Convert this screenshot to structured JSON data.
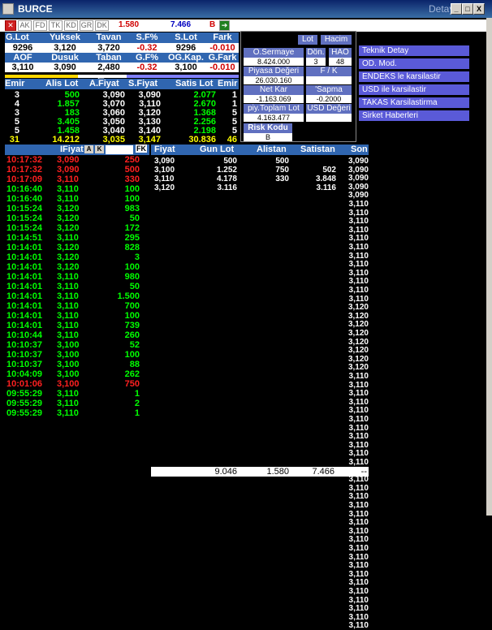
{
  "window": {
    "title": "BURCE",
    "subtitle": "Detay",
    "min": "_",
    "max": "□",
    "close": "X"
  },
  "toolbar": {
    "tabs": [
      "AK",
      "FD",
      "TK",
      "KD",
      "GR",
      "DK"
    ],
    "value1": "1.580",
    "value2": "7.466",
    "flag": "B"
  },
  "header": {
    "row1": [
      "G.Lot",
      "Yuksek",
      "Tavan",
      "S.F%",
      "S.Lot",
      "Fark"
    ],
    "row2": [
      "9296",
      "3,120",
      "3,720",
      "-0.32",
      "9296",
      "-0.010"
    ],
    "row3": [
      "AOF",
      "Dusuk",
      "Taban",
      "G.F%",
      "OG.Kap.",
      "G.Fark"
    ],
    "row4": [
      "3,110",
      "3,090",
      "2,480",
      "-0.32",
      "3,100",
      "-0.010"
    ]
  },
  "market": {
    "cols": [
      "Emir",
      "Alis Lot",
      "A.Fiyat",
      "S.Fiyat",
      "Satis Lot",
      "Emir"
    ],
    "arrow": "←"
  },
  "depth": [
    [
      "3",
      "500",
      "3,090",
      "3,090",
      "2.077",
      "1"
    ],
    [
      "4",
      "1.857",
      "3,070",
      "3,110",
      "2.670",
      "1"
    ],
    [
      "3",
      "183",
      "3,060",
      "3,120",
      "1.368",
      "5"
    ],
    [
      "5",
      "3.405",
      "3,050",
      "3,130",
      "2.256",
      "5"
    ],
    [
      "5",
      "1.458",
      "3,040",
      "3,140",
      "2.198",
      "5"
    ],
    [
      "31",
      "14.212",
      "3,035",
      "3,147",
      "30.836",
      "46"
    ]
  ],
  "infobox": {
    "buttons": [
      "Lot",
      "Hacim"
    ],
    "osermaye_lbl": "O.Sermaye",
    "osermaye": "8.424.000",
    "don_lbl": "Dön.",
    "don": "3",
    "hao_lbl": "HAO",
    "hao": "48",
    "piyasa_lbl": "Piyasa Değeri",
    "piyasa": "26.030.160",
    "fk_lbl": "F / K",
    "netkar_lbl": "Net Kar",
    "netkar": "-1.163.069",
    "sapma_lbl": "'Sapma",
    "sapma": "-0.2000",
    "toplam_lbl": "piy.Toplam Lot",
    "toplam": "4.163.477",
    "usd_lbl": "USD Değeri",
    "risk_lbl": "Risk Kodu",
    "risk": "B"
  },
  "links": [
    "Teknik Detay",
    "OD. Mod.",
    "ENDEKS le karsilastir",
    "USD ile karsilastir",
    "TAKAS Karsilastirma",
    "Sirket Haberleri"
  ],
  "trades_header": {
    "fiyat": "IFiyat",
    "a": "A",
    "k": "K",
    "fk": "FK"
  },
  "trades": [
    [
      "10:17:32",
      "3,090",
      "250",
      "red"
    ],
    [
      "10:17:32",
      "3,090",
      "500",
      "red"
    ],
    [
      "10:17:09",
      "3,110",
      "330",
      "red"
    ],
    [
      "10:16:40",
      "3,110",
      "100",
      "grn"
    ],
    [
      "10:16:40",
      "3,110",
      "100",
      "grn"
    ],
    [
      "10:15:24",
      "3,120",
      "983",
      "grn"
    ],
    [
      "10:15:24",
      "3,120",
      "50",
      "grn"
    ],
    [
      "10:15:24",
      "3,120",
      "172",
      "grn"
    ],
    [
      "10:14:51",
      "3,110",
      "295",
      "grn"
    ],
    [
      "10:14:01",
      "3,120",
      "828",
      "grn"
    ],
    [
      "10:14:01",
      "3,120",
      "3",
      "grn"
    ],
    [
      "10:14:01",
      "3,120",
      "100",
      "grn"
    ],
    [
      "10:14:01",
      "3,110",
      "980",
      "grn"
    ],
    [
      "10:14:01",
      "3,110",
      "50",
      "grn"
    ],
    [
      "10:14:01",
      "3,110",
      "1.500",
      "grn"
    ],
    [
      "10:14:01",
      "3,110",
      "700",
      "grn"
    ],
    [
      "10:14:01",
      "3,110",
      "100",
      "grn"
    ],
    [
      "10:14:01",
      "3,110",
      "739",
      "grn"
    ],
    [
      "10:10:44",
      "3,110",
      "260",
      "grn"
    ],
    [
      "10:10:37",
      "3,100",
      "52",
      "grn"
    ],
    [
      "10:10:37",
      "3,100",
      "100",
      "grn"
    ],
    [
      "10:10:37",
      "3,100",
      "88",
      "grn"
    ],
    [
      "10:04:09",
      "3,100",
      "262",
      "grn"
    ],
    [
      "10:01:06",
      "3,100",
      "750",
      "red"
    ],
    [
      "09:55:29",
      "3,110",
      "1",
      "grn"
    ],
    [
      "09:55:29",
      "3,110",
      "2",
      "grn"
    ],
    [
      "09:55:29",
      "3,110",
      "1",
      "grn"
    ]
  ],
  "price_header": [
    "Fiyat",
    "Gun Lot",
    "Alistan",
    "Satistan",
    "Son"
  ],
  "price_rows": [
    [
      "3,090",
      "500",
      "500",
      ""
    ],
    [
      "3,100",
      "1.252",
      "750",
      "502"
    ],
    [
      "3,110",
      "4.178",
      "330",
      "3.848"
    ],
    [
      "3,120",
      "3.116",
      "",
      "3.116"
    ]
  ],
  "son": [
    "3,090",
    "3,090",
    "3,090",
    "3,090",
    "3,090",
    "3,110",
    "3,110",
    "3,110",
    "3,110",
    "3,110",
    "3,110",
    "3,110",
    "3,110",
    "3,110",
    "3,110",
    "3,110",
    "3,110",
    "3,120",
    "3,120",
    "3,120",
    "3,120",
    "3,120",
    "3,120",
    "3,120",
    "3,120",
    "3,110",
    "3,110",
    "3,110",
    "3,110",
    "3,110",
    "3,110",
    "3,110",
    "3,110",
    "3,110",
    "3,110",
    "3,110",
    "3,110",
    "3,110",
    "3,110",
    "3,110",
    "3,110",
    "3,110",
    "3,110",
    "3,110",
    "3,110",
    "3,110",
    "3,110",
    "3,110",
    "3,110",
    "3,110",
    "3,110",
    "3,110",
    "3,110",
    "3,110",
    "3,110"
  ],
  "totals": [
    "9.046",
    "1.580",
    "7.466",
    "--"
  ]
}
